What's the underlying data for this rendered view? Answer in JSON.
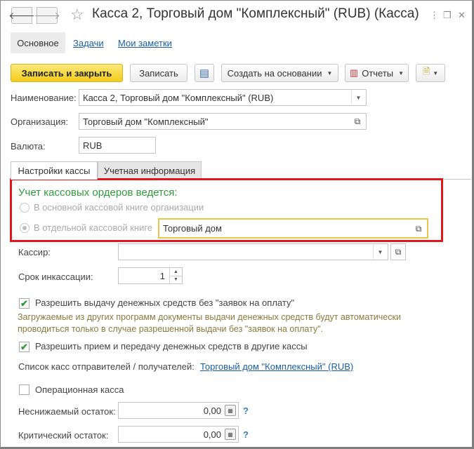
{
  "window": {
    "title": "Касса 2, Торговый дом \"Комплексный\" (RUB) (Касса)",
    "nav_back": "🡐",
    "nav_forward": "🡒",
    "star": "☆",
    "menu_icon": "⋮",
    "restore_icon": "❐",
    "close_icon": "✕"
  },
  "top_tabs": {
    "main": "Основное",
    "tasks": "Задачи",
    "notes": "Мои заметки"
  },
  "toolbar": {
    "save_close": "Записать и закрыть",
    "save": "Записать",
    "doc_icon": "▤",
    "create_based": "Создать на основании",
    "reports": "Отчеты",
    "reports_icon": "▥",
    "more_icon": "🗎",
    "caret": "▼"
  },
  "form": {
    "name_label": "Наименование:",
    "name_value": "Касса 2, Торговый дом \"Комплексный\" (RUB)",
    "org_label": "Организация:",
    "org_value": "Торговый дом \"Комплексный\"",
    "currency_label": "Валюта:",
    "currency_value": "RUB",
    "open_icon": "⧉"
  },
  "inner_tabs": {
    "settings": "Настройки кассы",
    "accounting": "Учетная информация"
  },
  "orders_section": {
    "title": "Учет кассовых ордеров ведется:",
    "option_main": "В основной кассовой книге организации",
    "option_separate": "В отдельной кассовой книге",
    "separate_value": "Торговый дом"
  },
  "settings": {
    "cashier_label": "Кассир:",
    "cashier_value": "",
    "collection_label": "Срок инкассации:",
    "collection_value": "1",
    "allow_issue_label": "Разрешить выдачу денежных средств без \"заявок на оплату\"",
    "allow_issue_hint": "Загружаемые из других программ документы выдачи денежных средств будут автоматически проводиться только в случае разрешенной выдачи без \"заявок на оплату\".",
    "allow_transfer_label": "Разрешить прием и передачу денежных средств в другие кассы",
    "senders_label": "Список касс отправителей / получателей:",
    "senders_link": "Торговый дом \"Комплексный\" (RUB)",
    "operational_label": "Операционная касса",
    "min_balance_label": "Неснижаемый остаток:",
    "min_balance_value": "0,00",
    "critical_balance_label": "Критический остаток:",
    "critical_balance_value": "0,00",
    "help": "?",
    "check": "✔",
    "calc_icon": "▦",
    "spin_up": "▲",
    "spin_down": "▼"
  },
  "state": {
    "allow_issue_checked": true,
    "allow_transfer_checked": true,
    "operational_checked": false,
    "selected_option": "separate"
  },
  "colors": {
    "primary_button": "#f3cc1a",
    "section_title": "#2e9c3c",
    "highlight_border": "#e0181b",
    "link": "#1a5ea8",
    "hint_text": "#8a7a3c"
  }
}
